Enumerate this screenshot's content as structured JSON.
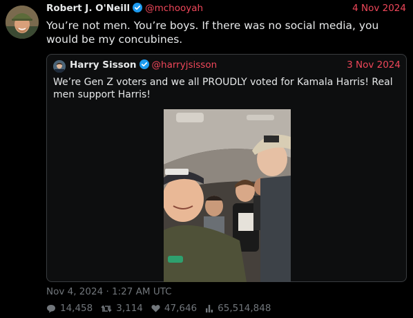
{
  "tweet": {
    "author_name": "Robert J. O'Neill",
    "author_handle": "@mchooyah",
    "date": "4 Nov 2024",
    "text": "You’re not men. You’re boys. If there was no social media, you would be my concubines.",
    "timestamp": "Nov 4, 2024 · 1:27 AM UTC"
  },
  "quoted": {
    "author_name": "Harry Sisson",
    "author_handle": "@harryjsisson",
    "date": "3 Nov 2024",
    "text": "We’re Gen Z voters and we all PROUDLY voted for Kamala Harris! Real men support Harris!"
  },
  "stats": {
    "replies": "14,458",
    "retweets": "3,114",
    "likes": "47,646",
    "views": "65,514,848"
  },
  "icons": {
    "verified": "verified-badge-icon",
    "reply": "comment-icon",
    "retweet": "retweet-icon",
    "like": "heart-icon",
    "views": "bar-chart-icon"
  },
  "colors": {
    "background": "#000000",
    "accent": "#f0475a",
    "verified": "#1d9bf0",
    "muted": "#71767b"
  }
}
